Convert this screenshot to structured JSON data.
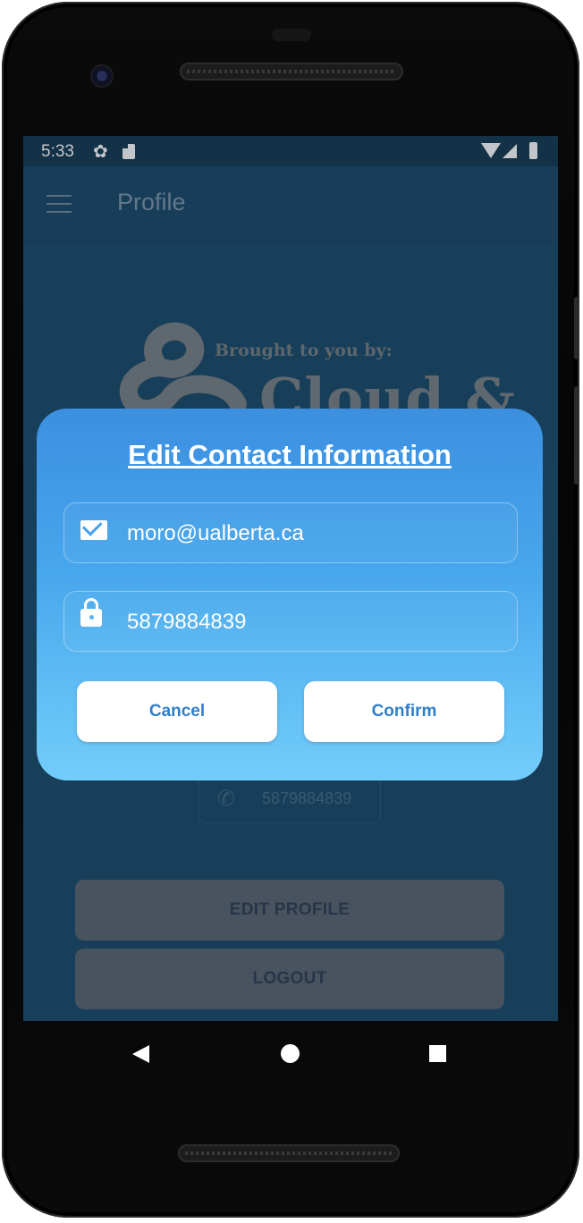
{
  "status": {
    "time": "5:33"
  },
  "appbar": {
    "title": "Profile"
  },
  "logo": {
    "tagline": "Brought to you by:",
    "word": "Cloud &"
  },
  "background": {
    "phone_number": "5879884839",
    "edit_profile_label": "EDIT PROFILE",
    "logout_label": "LOGOUT"
  },
  "dialog": {
    "title": "Edit Contact Information",
    "email_value": "moro@ualberta.ca",
    "phone_value": "5879884839",
    "cancel_label": "Cancel",
    "confirm_label": "Confirm"
  },
  "colors": {
    "screen_bg": "#1d4c6b",
    "dialog_top": "#3c8fe0",
    "dialog_bottom": "#73cdfb",
    "button_text": "#2f7fc8"
  }
}
